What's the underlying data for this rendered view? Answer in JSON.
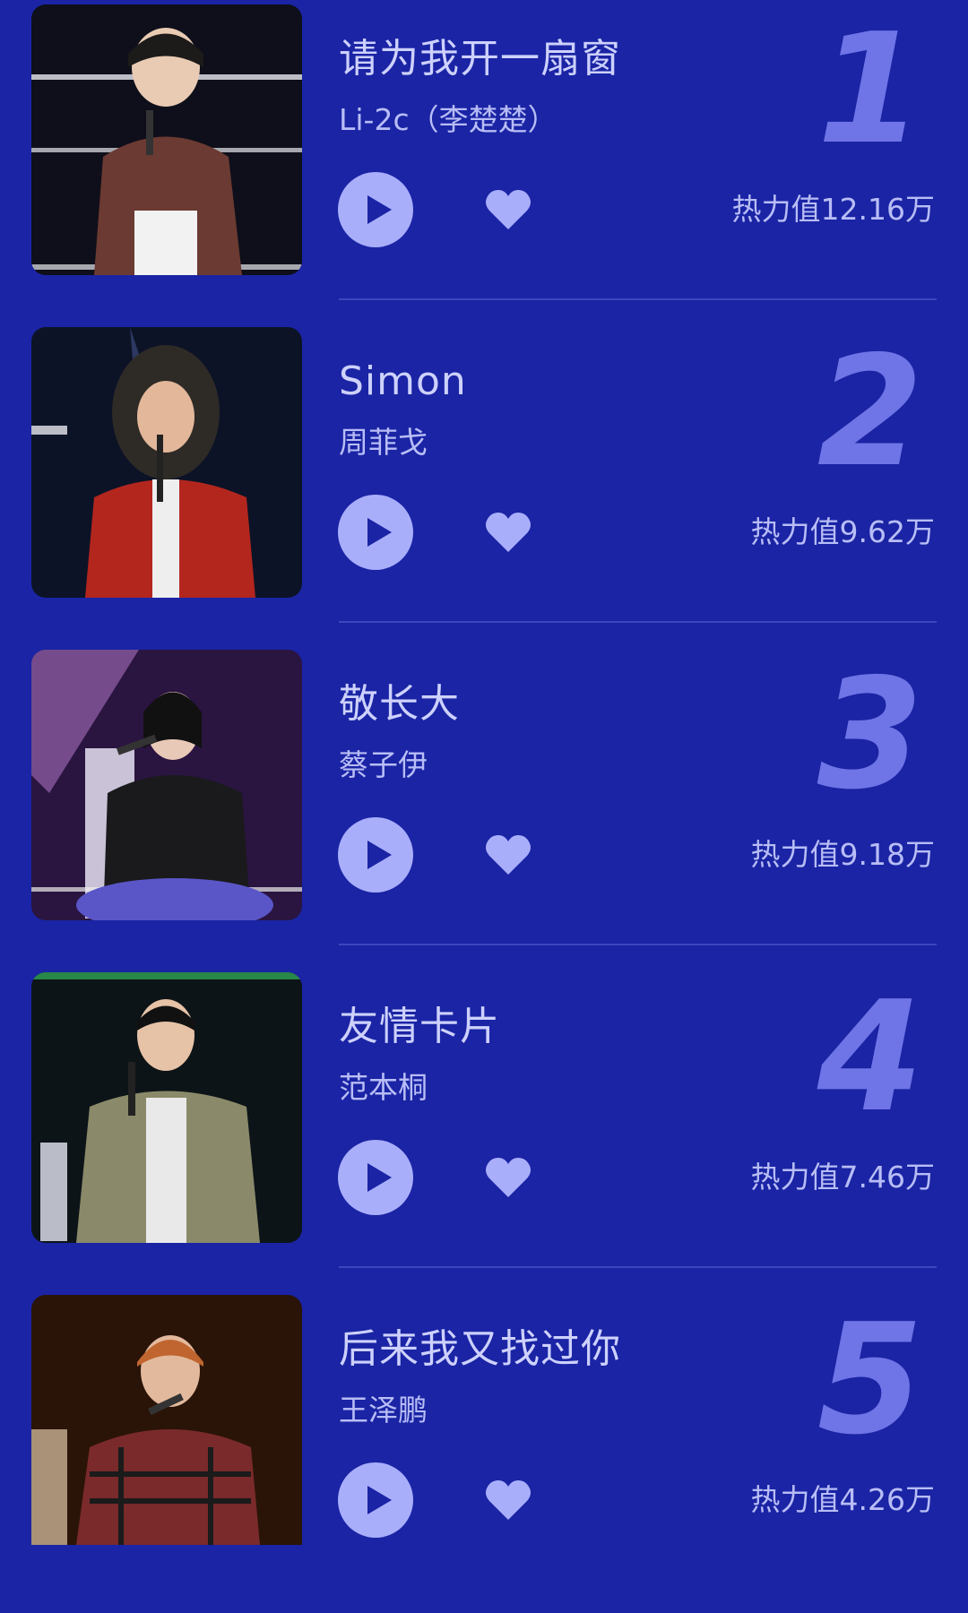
{
  "colors": {
    "background": "#1a24a4",
    "accent": "#a9aefb",
    "rank_number": "#6f74e6",
    "text": "#cdd1fc"
  },
  "songs": [
    {
      "rank": "1",
      "title": "请为我开一扇窗",
      "artist": "Li-2c（李楚楚）",
      "heat": "热力值12.16万",
      "photo_colors": [
        "#0e0f1a",
        "#6b3a32",
        "#f2f2f2"
      ]
    },
    {
      "rank": "2",
      "title": "Simon",
      "artist": "周菲戈",
      "heat": "热力值9.62万",
      "photo_colors": [
        "#0c1326",
        "#b3261e",
        "#2e2a26"
      ]
    },
    {
      "rank": "3",
      "title": "敬长大",
      "artist": "蔡子伊",
      "heat": "热力值9.18万",
      "photo_colors": [
        "#2a1440",
        "#1a1a1c",
        "#5a56c8"
      ]
    },
    {
      "rank": "4",
      "title": "友情卡片",
      "artist": "范本桐",
      "heat": "热力值7.46万",
      "photo_colors": [
        "#0d1418",
        "#8a8a6a",
        "#e9e9e9"
      ]
    },
    {
      "rank": "5",
      "title": "后来我又找过你",
      "artist": "王泽鹏",
      "heat": "热力值4.26万",
      "photo_colors": [
        "#2a1408",
        "#7a2a2a",
        "#c9a27a"
      ]
    }
  ],
  "icons": {
    "play": "play-icon",
    "like": "heart-icon"
  }
}
